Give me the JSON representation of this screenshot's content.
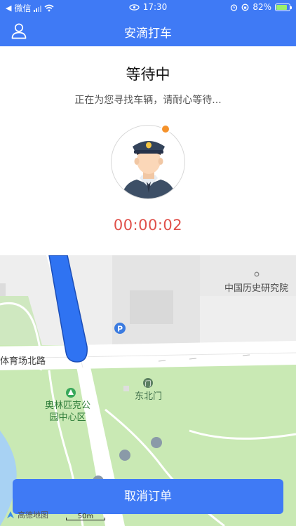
{
  "status_bar": {
    "carrier": "微信",
    "time": "17:30",
    "battery": "82%"
  },
  "header": {
    "title": "安滴打车",
    "user_icon": "user-icon"
  },
  "waiting": {
    "heading": "等待中",
    "message": "正在为您寻找车辆，请耐心等待...",
    "timer": "00:00:02",
    "avatar_icon": "driver-avatar-icon"
  },
  "map": {
    "road_name": "体育场北路",
    "institute": "中国历史研究院",
    "park_name_line1": "奥林匹克公",
    "park_name_line2": "园中心区",
    "gate": "东北门",
    "parking_icon": "parking-icon",
    "scale": "50m",
    "provider": "高德地图"
  },
  "actions": {
    "cancel_order": "取消订单"
  },
  "colors": {
    "primary": "#3f7af5",
    "timer": "#e0504a",
    "map_green": "#c9e9b4",
    "notification_dot": "#f5922b"
  }
}
